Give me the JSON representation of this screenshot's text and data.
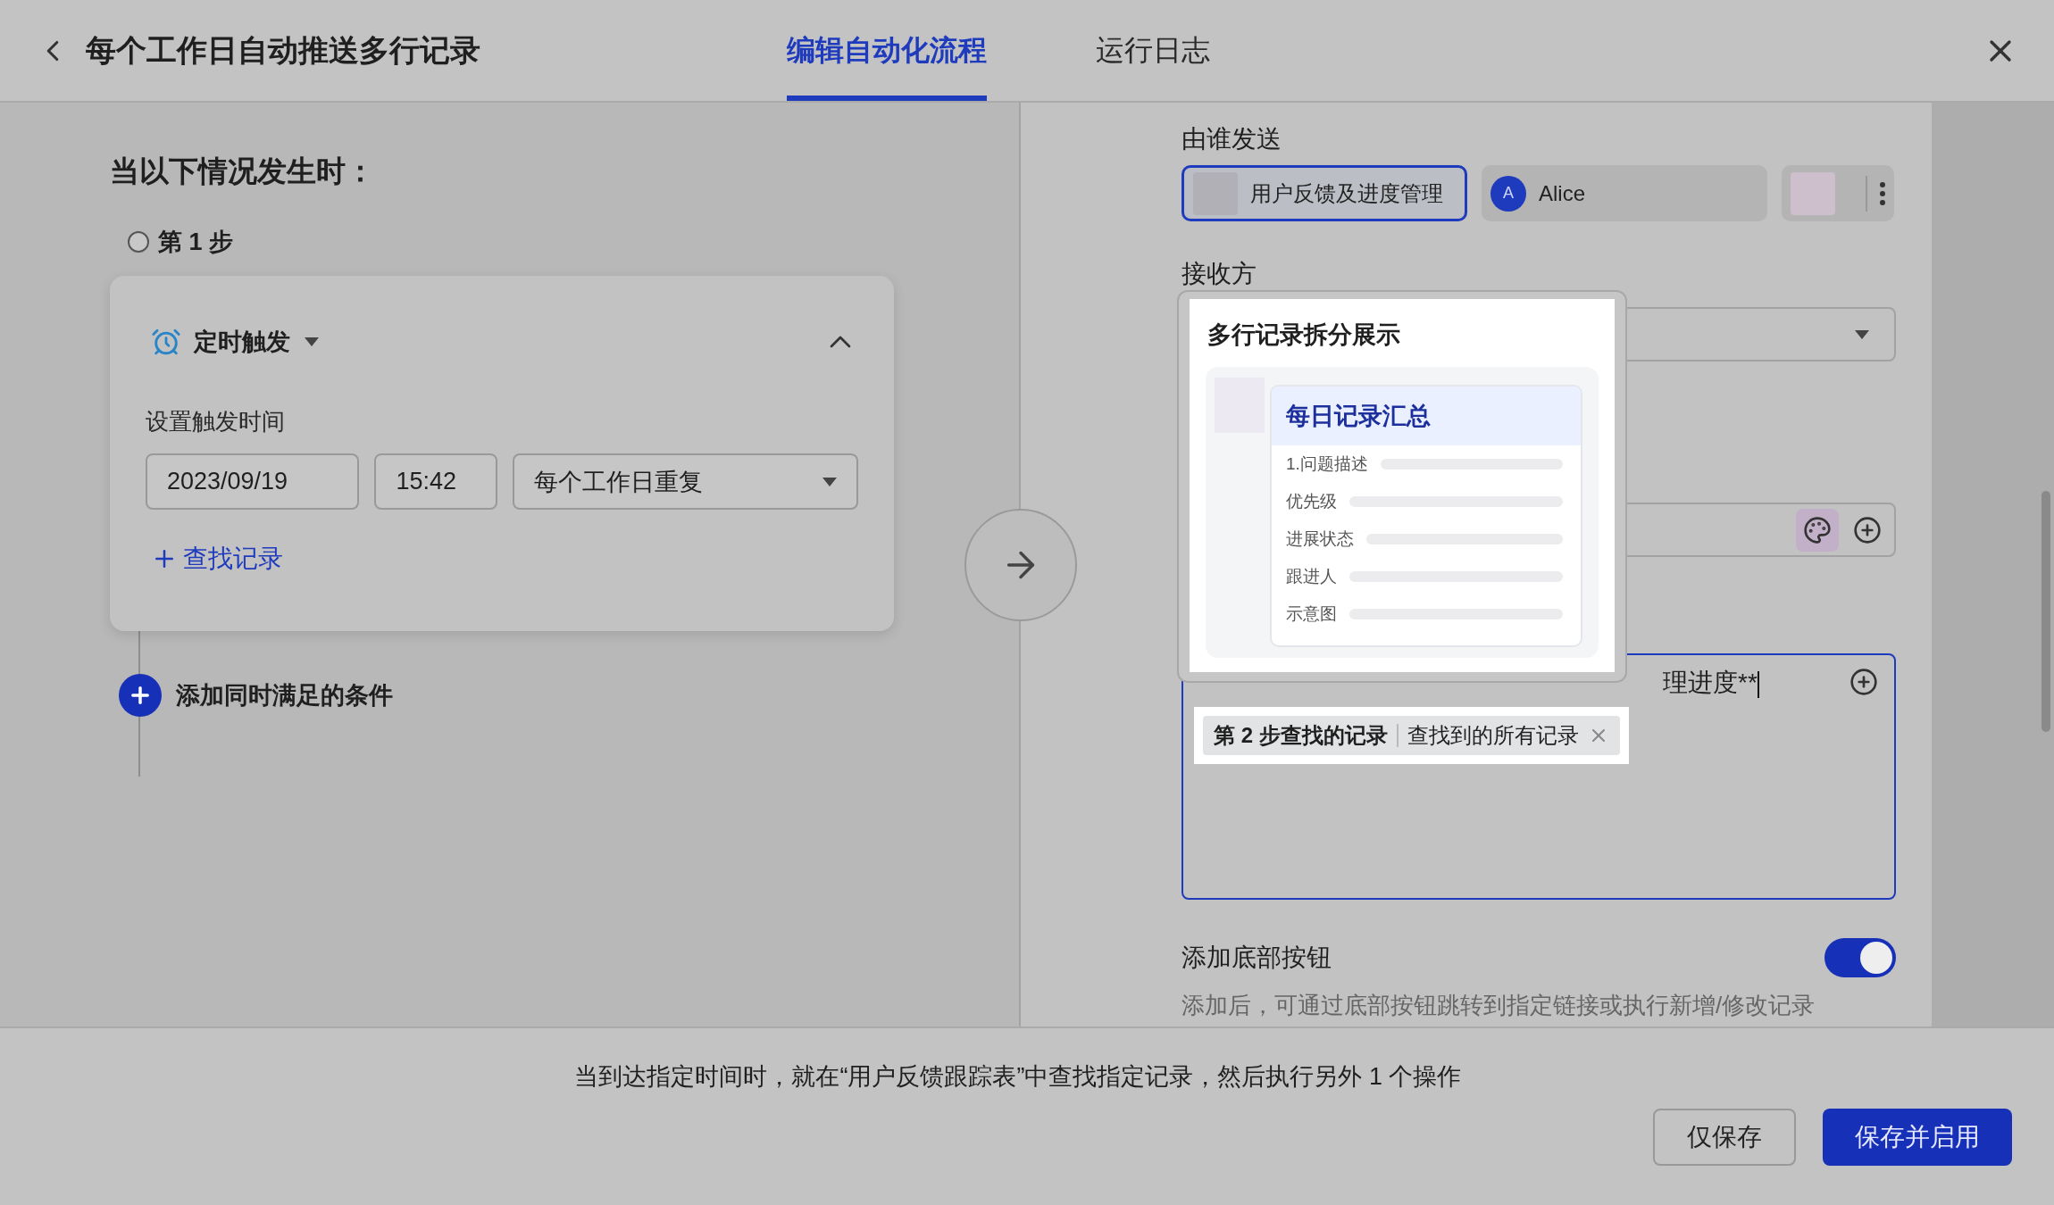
{
  "header": {
    "title": "每个工作日自动推送多行记录",
    "tabs": [
      {
        "label": "编辑自动化流程",
        "selected": true
      },
      {
        "label": "运行日志",
        "selected": false
      }
    ]
  },
  "trigger_panel": {
    "heading": "当以下情况发生时：",
    "step": "第 1 步",
    "trigger": {
      "name": "定时触发",
      "expanded": true,
      "time_label": "设置触发时间",
      "date": "2023/09/19",
      "time": "15:42",
      "repeat": "每个工作日重复",
      "find_record": "查找记录"
    },
    "add_condition": "添加同时满足的条件"
  },
  "action_panel": {
    "sender_label": "由谁发送",
    "senders": [
      {
        "kind": "bot",
        "label": "用户反馈及进度管理",
        "selected": true
      },
      {
        "kind": "user",
        "label": "Alice",
        "avatar": "A",
        "selected": false
      },
      {
        "kind": "more",
        "selected": false
      }
    ],
    "receiver_label": "接收方",
    "content_text": "理进度**",
    "record_chip": {
      "source": "第 2 步查找的记录",
      "scope": "查找到的所有记录"
    },
    "bottom_button": {
      "label": "添加底部按钮",
      "on": true,
      "hint": "添加后，可通过底部按钮跳转到指定链接或执行新增/修改记录"
    }
  },
  "popover": {
    "title": "多行记录拆分展示",
    "preview": {
      "title": "每日记录汇总",
      "fields": [
        "1.问题描述",
        "优先级",
        "进展状态",
        "跟进人",
        "示意图"
      ]
    }
  },
  "footer": {
    "summary": "当到达指定时间时，就在“用户反馈跟踪表”中查找指定记录，然后执行另外 1 个操作",
    "buttons": [
      {
        "label": "仅保存",
        "kind": "secondary"
      },
      {
        "label": "保存并启用",
        "kind": "primary"
      }
    ]
  }
}
